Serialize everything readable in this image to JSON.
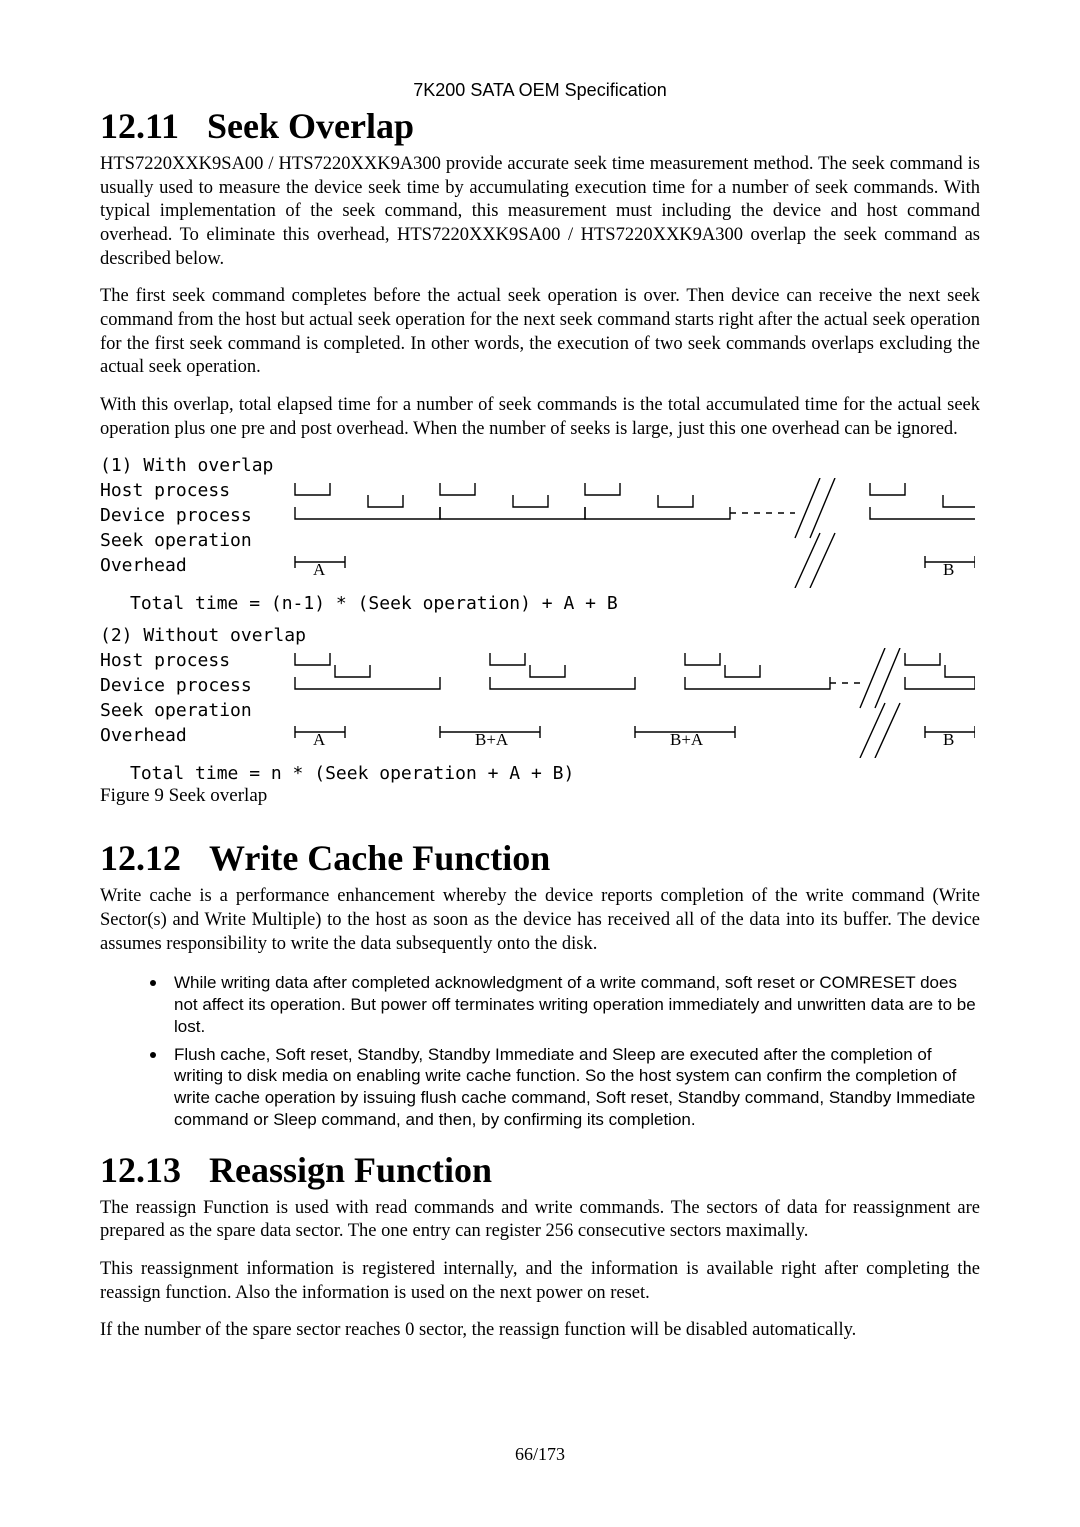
{
  "header": "7K200 SATA OEM Specification",
  "sections": {
    "s12_11": {
      "number": "12.11",
      "title": "Seek Overlap",
      "p1": "HTS7220XXK9SA00 / HTS7220XXK9A300 provide accurate seek time measurement method. The seek command is usually used to measure the device seek time by accumulating execution time for a number of seek commands. With typical implementation of the seek command, this measurement must including the device and host command overhead. To eliminate this overhead, HTS7220XXK9SA00 / HTS7220XXK9A300 overlap the seek command as described below.",
      "p2": "The first seek command completes before the actual seek operation is over. Then device can receive the next seek command from the host but actual seek operation for the next seek command starts right after the actual seek operation for the first seek command is completed. In other words, the execution of two seek commands overlaps excluding the actual seek operation.",
      "p3": "With this overlap, total elapsed time for a number of seek commands is the total accumulated time for the actual seek operation plus one pre and post overhead. When the number of seeks is large, just this one overhead can be ignored.",
      "figure": {
        "title1": "(1) With overlap",
        "title2": "(2) Without overlap",
        "rows": [
          "Host process",
          "Device process",
          "Seek operation",
          "Overhead"
        ],
        "markers": {
          "A": "A",
          "B": "B",
          "BA": "B+A"
        },
        "formula1": "Total time = (n-1) * (Seek operation) + A + B",
        "formula2": "Total time = n * (Seek operation + A + B)",
        "caption": "Figure 9 Seek overlap"
      }
    },
    "s12_12": {
      "number": "12.12",
      "title": "Write Cache Function",
      "p1": "Write cache is a performance enhancement whereby the device reports completion of the write command (Write Sector(s) and Write Multiple) to the host as soon as the device has received all of the data into its buffer. The device assumes responsibility to write the data subsequently onto the disk.",
      "bullets": [
        "While writing data after completed acknowledgment of a write command, soft reset or COMRESET does not affect its operation. But power off terminates writing operation immediately and unwritten data are to be lost.",
        "Flush cache, Soft reset, Standby, Standby Immediate and Sleep are executed after the completion of writing to disk media on enabling write cache function. So the host system can confirm the completion of write cache operation by issuing flush cache command, Soft reset, Standby command, Standby Immediate command or Sleep command, and then, by confirming its completion."
      ]
    },
    "s12_13": {
      "number": "12.13",
      "title": "Reassign Function",
      "p1": "The reassign Function is used with read commands and write commands. The sectors of data for reassignment are prepared as the spare data sector. The one entry can register 256 consecutive sectors maximally.",
      "p2": "This reassignment information is registered internally, and the information is available right after completing the reassign function. Also the information is used on the next power on reset.",
      "p3": "If the number of the spare sector reaches 0 sector, the reassign function will be disabled automatically."
    }
  },
  "page_number": "66/173"
}
